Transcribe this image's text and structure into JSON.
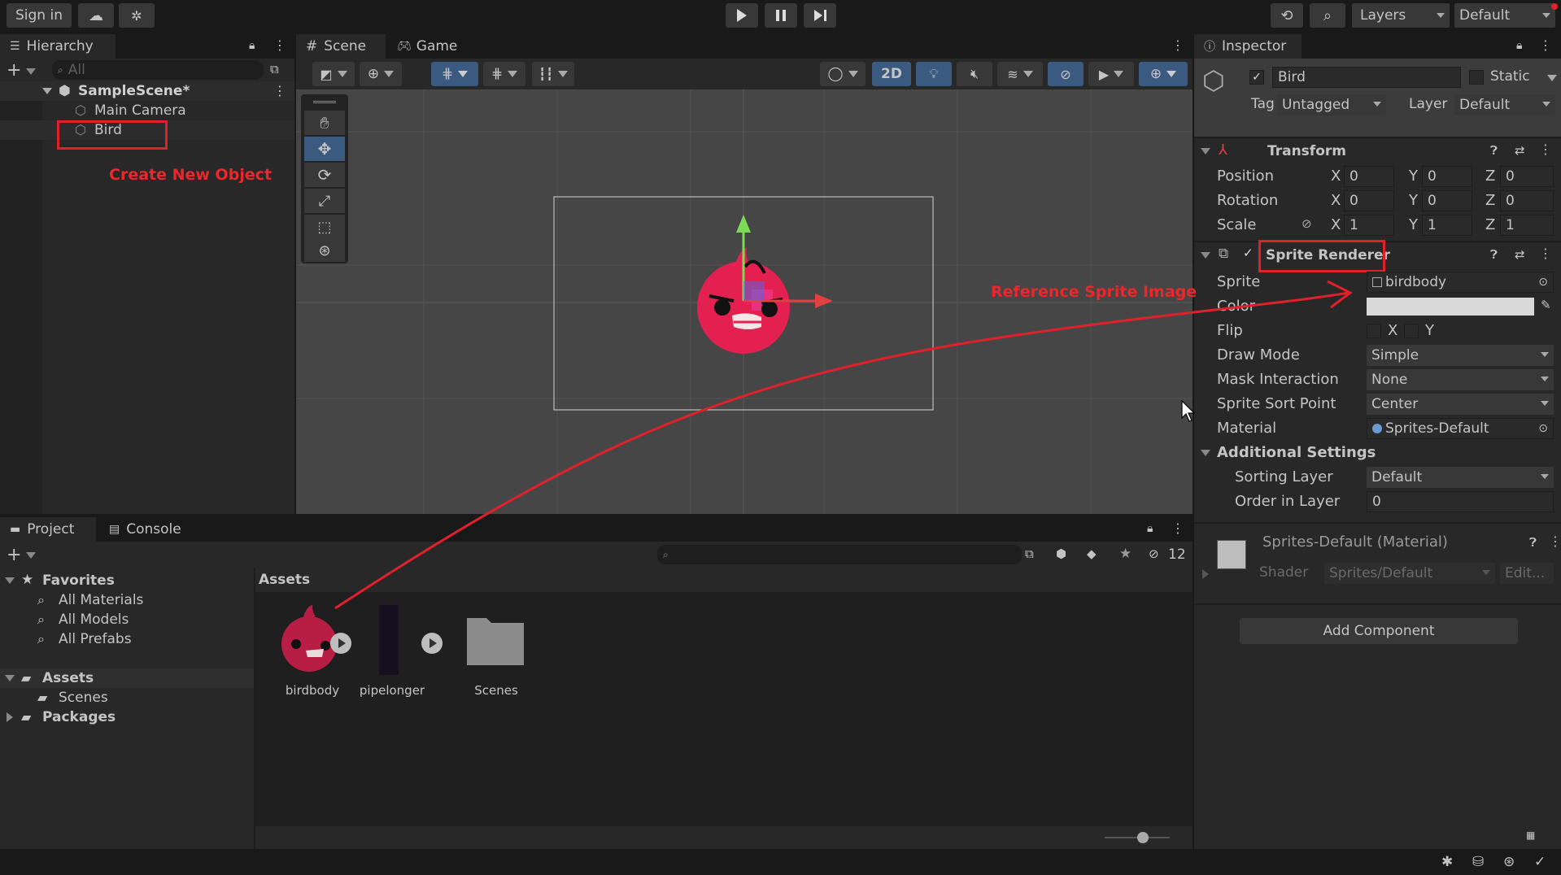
{
  "colors": {
    "accent_red": "#e0202a",
    "bird_pink": "#e3204f",
    "selection_blue": "#3a5a80",
    "gizmo_green": "#7ed957",
    "gizmo_red": "#e04040"
  },
  "toolbar": {
    "sign_in": "Sign in",
    "layers": "Layers",
    "layout": "Default"
  },
  "hierarchy": {
    "tab": "Hierarchy",
    "search_placeholder": "All",
    "scene": "SampleScene*",
    "items": [
      "Main Camera",
      "Bird"
    ]
  },
  "scene_view": {
    "tabs": [
      "Scene",
      "Game"
    ],
    "mode_2d": "2D"
  },
  "project": {
    "tabs": [
      "Project",
      "Console"
    ],
    "favorites_label": "Favorites",
    "favorites": [
      "All Materials",
      "All Models",
      "All Prefabs"
    ],
    "assets_label": "Assets",
    "assets_children": [
      "Scenes"
    ],
    "packages_label": "Packages",
    "breadcrumb": "Assets",
    "hidden_count": "12",
    "assets": [
      {
        "name": "birdbody",
        "icon": "bird-sprite"
      },
      {
        "name": "pipelonger",
        "icon": "pipe-sprite"
      },
      {
        "name": "Scenes",
        "icon": "folder-icon"
      }
    ]
  },
  "inspector": {
    "tab": "Inspector",
    "object_name": "Bird",
    "static_label": "Static",
    "tag_label": "Tag",
    "tag_value": "Untagged",
    "layer_label": "Layer",
    "layer_value": "Default",
    "transform": {
      "title": "Transform",
      "position_label": "Position",
      "rotation_label": "Rotation",
      "scale_label": "Scale",
      "position": [
        "0",
        "0",
        "0"
      ],
      "rotation": [
        "0",
        "0",
        "0"
      ],
      "scale": [
        "1",
        "1",
        "1"
      ],
      "axes": [
        "X",
        "Y",
        "Z"
      ]
    },
    "sprite_renderer": {
      "title": "Sprite Renderer",
      "sprite_label": "Sprite",
      "sprite_value": "birdbody",
      "color_label": "Color",
      "flip_label": "Flip",
      "flip_x": "X",
      "flip_y": "Y",
      "draw_mode_label": "Draw Mode",
      "draw_mode_value": "Simple",
      "mask_label": "Mask Interaction",
      "mask_value": "None",
      "sort_point_label": "Sprite Sort Point",
      "sort_point_value": "Center",
      "material_label": "Material",
      "material_value": "Sprites-Default",
      "additional_label": "Additional Settings",
      "sorting_layer_label": "Sorting Layer",
      "sorting_layer_value": "Default",
      "order_label": "Order in Layer",
      "order_value": "0"
    },
    "material_section": {
      "title": "Sprites-Default (Material)",
      "shader_label": "Shader",
      "shader_value": "Sprites/Default",
      "edit_label": "Edit..."
    },
    "add_component": "Add Component"
  },
  "annotations": {
    "create_new_object": "Create New Object",
    "reference_sprite": "Reference Sprite Image"
  }
}
